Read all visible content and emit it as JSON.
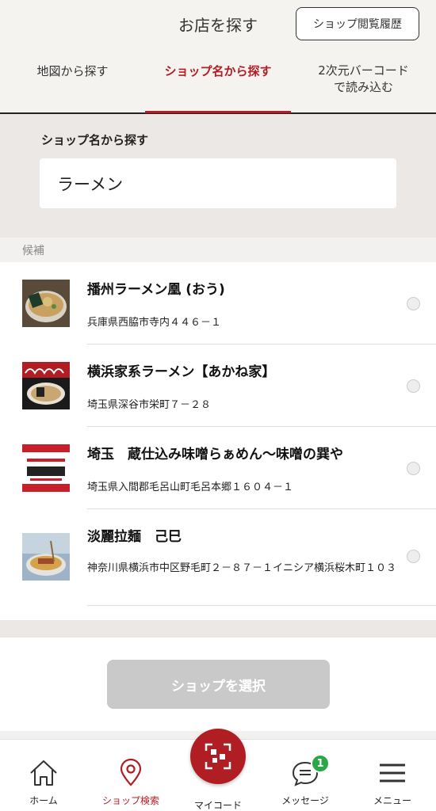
{
  "header": {
    "title": "お店を探す",
    "history_button": "ショップ閲覧履歴"
  },
  "tabs": [
    {
      "label": "地図から探す",
      "active": false
    },
    {
      "label": "ショップ名から探す",
      "active": true
    },
    {
      "label": "2次元バーコード\nで読み込む",
      "active": false
    }
  ],
  "search": {
    "label": "ショップ名から探す",
    "value": "ラーメン"
  },
  "candidates_label": "候補",
  "shops": [
    {
      "name": "播州ラーメン凰 (おう)",
      "address": "兵庫県西脇市寺内４４６－１",
      "thumb_icon": "ramen-bowl-photo"
    },
    {
      "name": "横浜家系ラーメン【あかね家】",
      "address": "埼玉県深谷市栄町７－２８",
      "thumb_icon": "akaneya-logo"
    },
    {
      "name": "埼玉　蔵仕込み味噌らぁめん〜味噌の巽や",
      "address": "埼玉県入間郡毛呂山町毛呂本郷１６０４－１",
      "thumb_icon": "tatsumiya-logo"
    },
    {
      "name": "淡麗拉麺　己巳",
      "address": "神奈川県横浜市中区野毛町２－８７－１イニシア横浜桜木町１０３",
      "thumb_icon": "ramen-bowl-photo"
    }
  ],
  "select_button": "ショップを選択",
  "nav": {
    "items": [
      {
        "label": "ホーム",
        "icon": "home-icon"
      },
      {
        "label": "ショップ検索",
        "icon": "location-pin-icon"
      },
      {
        "label": "マイコード",
        "icon": "qr-code-icon"
      },
      {
        "label": "メッセージ",
        "icon": "message-icon"
      },
      {
        "label": "メニュー",
        "icon": "menu-icon"
      }
    ],
    "message_badge": "1"
  },
  "colors": {
    "accent": "#b01e23",
    "badge": "#2aa845",
    "disabled_button": "#c9c9c9"
  }
}
